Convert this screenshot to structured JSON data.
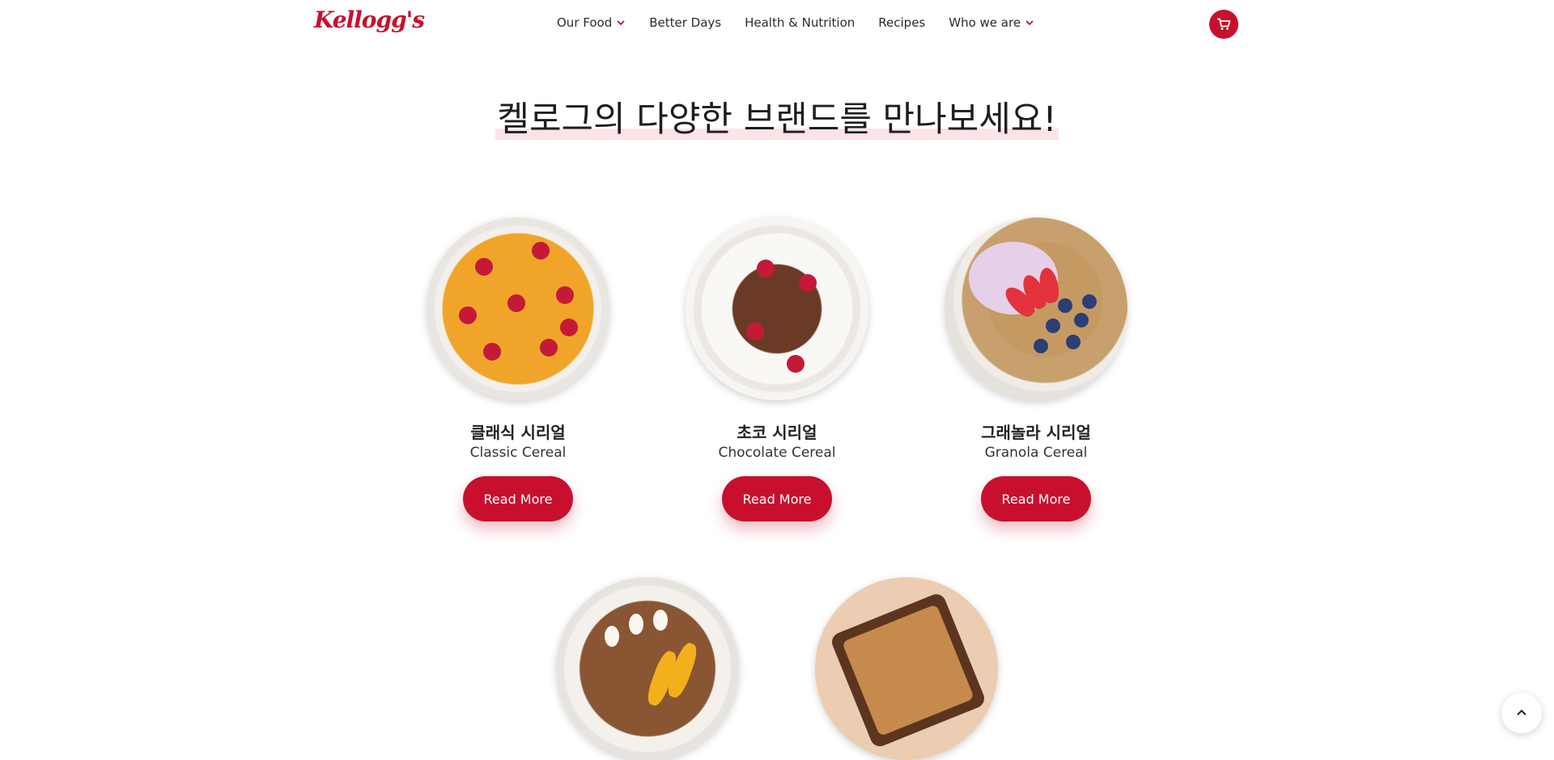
{
  "header": {
    "logo_text": "Kellogg's",
    "nav": [
      {
        "label": "Our Food",
        "has_dropdown": true
      },
      {
        "label": "Better Days",
        "has_dropdown": false
      },
      {
        "label": "Health & Nutrition",
        "has_dropdown": false
      },
      {
        "label": "Recipes",
        "has_dropdown": false
      },
      {
        "label": "Who we are",
        "has_dropdown": true
      }
    ],
    "cart_icon": "shopping-cart-icon"
  },
  "main": {
    "title": "켈로그의 다양한 브랜드를 만나보세요!",
    "products": [
      {
        "korean": "클래식 시리얼",
        "english": "Classic Cereal",
        "button": "Read More"
      },
      {
        "korean": "초코 시리얼",
        "english": "Chocolate Cereal",
        "button": "Read More"
      },
      {
        "korean": "그래놀라 시리얼",
        "english": "Granola Cereal",
        "button": "Read More"
      }
    ]
  },
  "back_to_top_icon": "chevron-up-icon",
  "colors": {
    "brand_red": "#c8102e",
    "title_highlight": "#fbe3e8"
  }
}
